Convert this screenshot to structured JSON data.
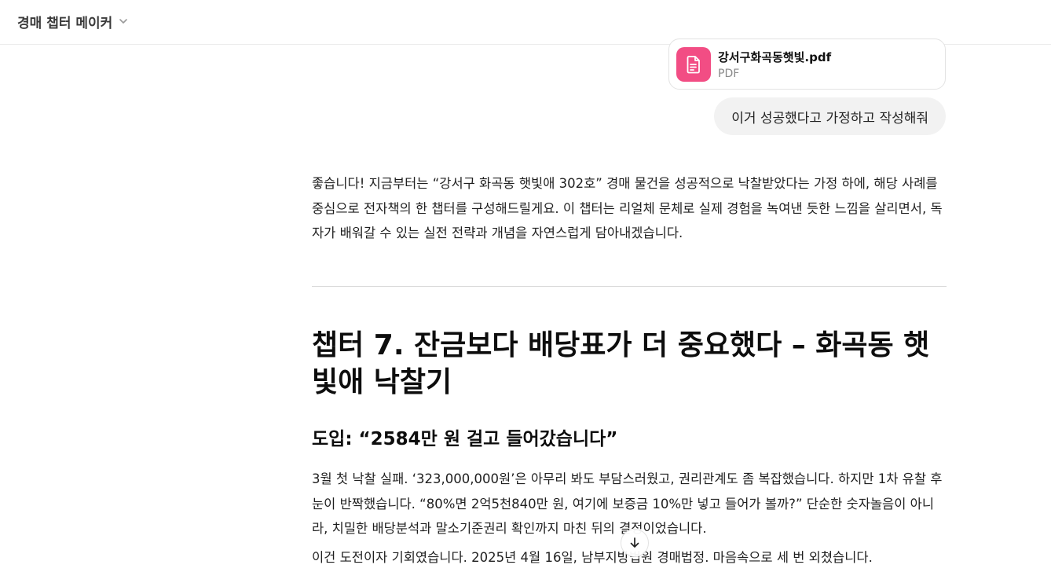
{
  "header": {
    "title": "경매 챕터 메이커",
    "dropdown_icon": "chevron-down-icon"
  },
  "attachment": {
    "name": "강서구화곡동햇빛.pdf",
    "type": "PDF",
    "icon": "document-icon",
    "icon_color": "#f24d84"
  },
  "user_message": "이거 성공했다고 가정하고 작성해줘",
  "response": {
    "intro": "좋습니다! 지금부터는 “강서구 화곡동 햇빛애 302호” 경매 물건을 성공적으로 낙찰받았다는 가정 하에, 해당 사례를 중심으로 전자책의 한 챕터를 구성해드릴게요. 이 챕터는 리얼체 문체로 실제 경험을 녹여낸 듯한 느낌을 살리면서, 독자가 배워갈 수 있는 실전 전략과 개념을 자연스럽게 담아내겠습니다.",
    "chapter_title": "챕터 7. 잔금보다 배당표가 더 중요했다 – 화곡동 햇빛애 낙찰기",
    "section_title": "도입: “2584만 원 걸고 들어갔습니다”",
    "paragraph1": "3월 첫 낙찰 실패. ‘323,000,000원’은 아무리 봐도 부담스러웠고, 권리관계도 좀 복잡했습니다. 하지만 1차 유찰 후 눈이 반짝했습니다. “80%면 2억5천840만 원, 여기에 보증금 10%만 넣고 들어가 볼까?” 단순한 숫자놀음이 아니라, 치밀한 배당분석과 말소기준권리 확인까지 마친 뒤의 결정이었습니다.",
    "paragraph2": "이건 도전이자 기회였습니다. 2025년 4월 16일, 남부지방법원 경매법정. 마음속으로 세 번 외쳤습니다."
  },
  "scroll_button_icon": "arrow-down-icon"
}
